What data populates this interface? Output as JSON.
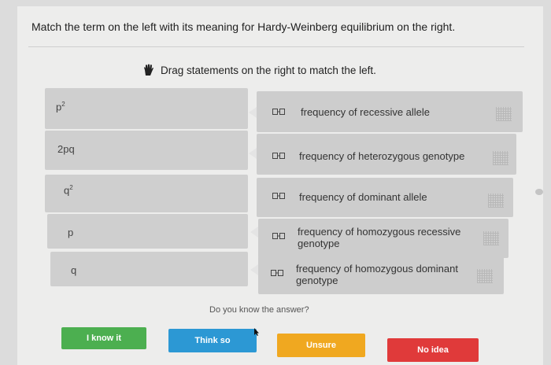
{
  "question": "Match the term on the left with its meaning for Hardy-Weinberg equilibrium on the right.",
  "instruction": "Drag statements on the right to match the left.",
  "instruction_icon": "hand-icon",
  "terms": [
    {
      "base": "p",
      "sup": "2"
    },
    {
      "base": "2pq",
      "sup": ""
    },
    {
      "base": "q",
      "sup": "2"
    },
    {
      "base": "p",
      "sup": ""
    },
    {
      "base": "q",
      "sup": ""
    }
  ],
  "statements": [
    {
      "text": "frequency of recessive allele"
    },
    {
      "text": "frequency of heterozygous genotype"
    },
    {
      "text": "frequency of dominant allele"
    },
    {
      "text": "frequency of homozygous recessive genotype"
    },
    {
      "text": "frequency of homozygous dominant genotype"
    }
  ],
  "prompt": "Do you know the answer?",
  "buttons": {
    "know": {
      "label": "I know it",
      "color": "#4caf50"
    },
    "think": {
      "label": "Think so",
      "color": "#2c98d4"
    },
    "unsure": {
      "label": "Unsure",
      "color": "#f0a820"
    },
    "noidea": {
      "label": "No idea",
      "color": "#e03a3a"
    }
  }
}
